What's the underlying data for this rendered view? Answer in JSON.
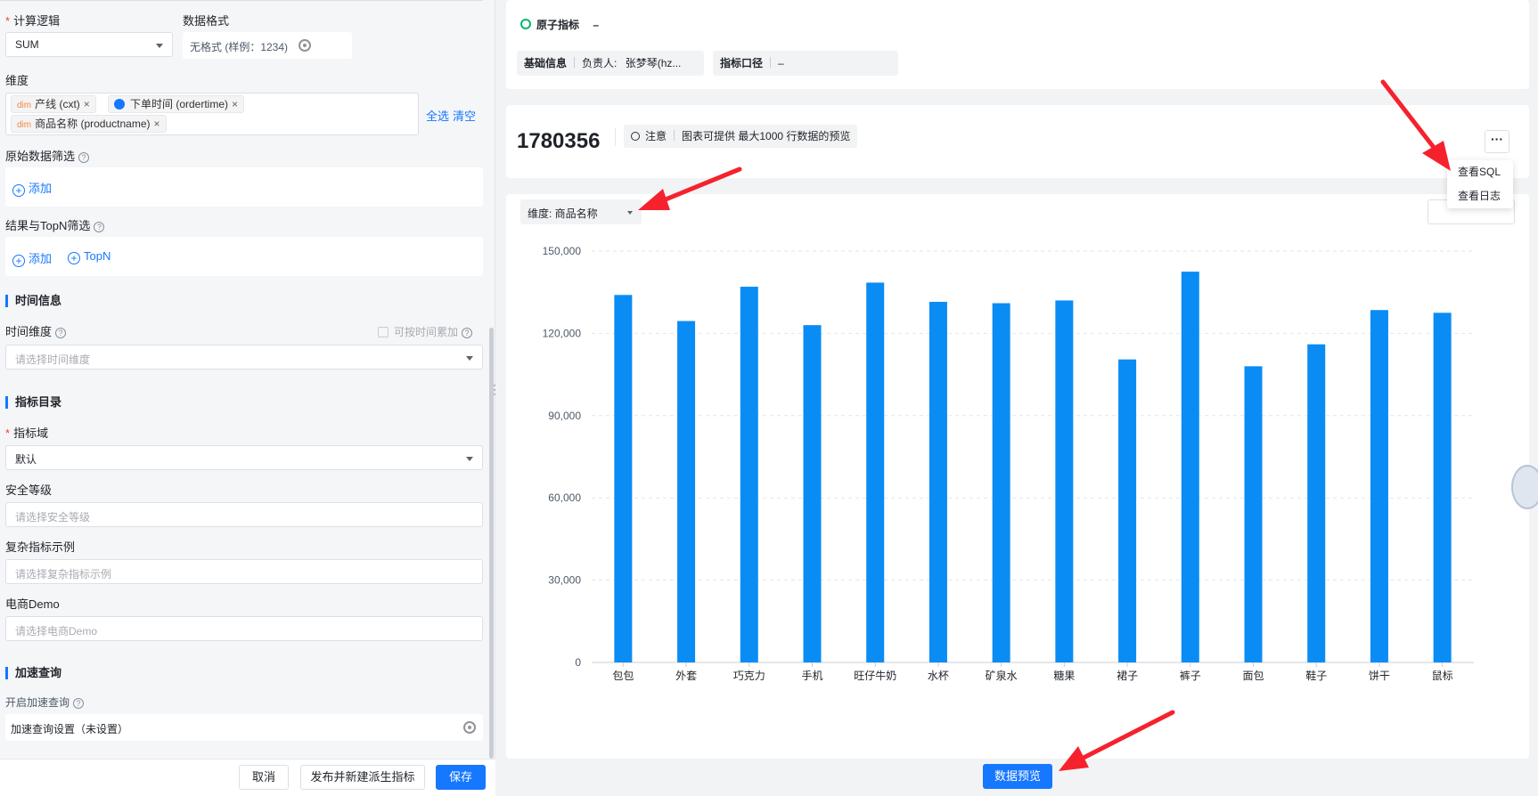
{
  "left": {
    "calc_label": "计算逻辑",
    "calc_value": "SUM",
    "format_label": "数据格式",
    "format_value": "无格式 (样例：1234)",
    "dimension_label": "维度",
    "dim_tag_prefix": "dim",
    "dimension_tags": [
      "产线 (cxt)",
      "下单时间 (ordertime)",
      "商品名称 (productname)"
    ],
    "select_all": "全选",
    "clear": "清空",
    "raw_filter_label": "原始数据筛选",
    "add": "添加",
    "result_filter_label": "结果与TopN筛选",
    "topn": "TopN",
    "time_section": "时间信息",
    "time_dim_label": "时间维度",
    "time_accumulate": "可按时间累加",
    "time_dim_placeholder": "请选择时间维度",
    "catalog_section": "指标目录",
    "domain_label": "指标域",
    "domain_value": "默认",
    "security_label": "安全等级",
    "security_placeholder": "请选择安全等级",
    "complex_label": "复杂指标示例",
    "complex_placeholder": "请选择复杂指标示例",
    "ecom_label": "电商Demo",
    "ecom_placeholder": "请选择电商Demo",
    "accel_section": "加速查询",
    "accel_enable": "开启加速查询",
    "accel_settings": "加速查询设置（未设置）"
  },
  "footer": {
    "cancel": "取消",
    "publish": "发布并新建派生指标",
    "save": "保存"
  },
  "right": {
    "atomic_label": "原子指标",
    "atomic_value": "–",
    "basic_info": "基础信息",
    "owner_label": "负责人:",
    "owner_value": "张梦琴(hz...",
    "caliber_label": "指标口径",
    "caliber_value": "–",
    "total_value": "1780356",
    "notice_label": "注意",
    "notice_text": "图表可提供 最大1000 行数据的预览",
    "more": "···",
    "menu_items": [
      "查看SQL",
      "查看日志"
    ],
    "dimension_select": "维度: 商品名称",
    "preview_button": "数据预览"
  },
  "colors": {
    "accent": "#1677ff",
    "bar": "#0a8cf5",
    "required": "#f53f3f",
    "arrow": "#f5222d"
  },
  "chart_data": {
    "type": "bar",
    "categories": [
      "包包",
      "外套",
      "巧克力",
      "手机",
      "旺仔牛奶",
      "水杯",
      "矿泉水",
      "糖果",
      "裙子",
      "裤子",
      "面包",
      "鞋子",
      "饼干",
      "鼠标"
    ],
    "values": [
      134000,
      124500,
      137000,
      123000,
      138500,
      131500,
      131000,
      132000,
      110500,
      142500,
      108000,
      116000,
      128500,
      127500
    ],
    "ylim": [
      0,
      150000
    ],
    "yticks": [
      0,
      30000,
      60000,
      90000,
      120000,
      150000
    ],
    "ytick_labels": [
      "0",
      "30,000",
      "60,000",
      "90,000",
      "120,000",
      "150,000"
    ],
    "grid": true
  }
}
